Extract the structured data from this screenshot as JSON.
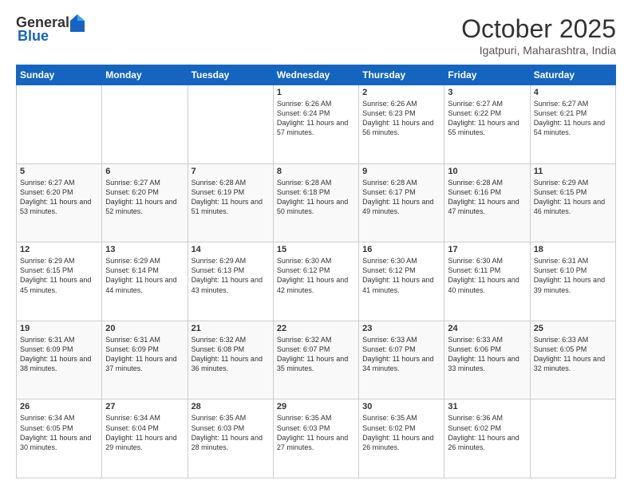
{
  "header": {
    "logo_general": "General",
    "logo_blue": "Blue",
    "month_title": "October 2025",
    "location": "Igatpuri, Maharashtra, India"
  },
  "days_of_week": [
    "Sunday",
    "Monday",
    "Tuesday",
    "Wednesday",
    "Thursday",
    "Friday",
    "Saturday"
  ],
  "weeks": [
    [
      {
        "day": "",
        "info": ""
      },
      {
        "day": "",
        "info": ""
      },
      {
        "day": "",
        "info": ""
      },
      {
        "day": "1",
        "info": "Sunrise: 6:26 AM\nSunset: 6:24 PM\nDaylight: 11 hours and 57 minutes."
      },
      {
        "day": "2",
        "info": "Sunrise: 6:26 AM\nSunset: 6:23 PM\nDaylight: 11 hours and 56 minutes."
      },
      {
        "day": "3",
        "info": "Sunrise: 6:27 AM\nSunset: 6:22 PM\nDaylight: 11 hours and 55 minutes."
      },
      {
        "day": "4",
        "info": "Sunrise: 6:27 AM\nSunset: 6:21 PM\nDaylight: 11 hours and 54 minutes."
      }
    ],
    [
      {
        "day": "5",
        "info": "Sunrise: 6:27 AM\nSunset: 6:20 PM\nDaylight: 11 hours and 53 minutes."
      },
      {
        "day": "6",
        "info": "Sunrise: 6:27 AM\nSunset: 6:20 PM\nDaylight: 11 hours and 52 minutes."
      },
      {
        "day": "7",
        "info": "Sunrise: 6:28 AM\nSunset: 6:19 PM\nDaylight: 11 hours and 51 minutes."
      },
      {
        "day": "8",
        "info": "Sunrise: 6:28 AM\nSunset: 6:18 PM\nDaylight: 11 hours and 50 minutes."
      },
      {
        "day": "9",
        "info": "Sunrise: 6:28 AM\nSunset: 6:17 PM\nDaylight: 11 hours and 49 minutes."
      },
      {
        "day": "10",
        "info": "Sunrise: 6:28 AM\nSunset: 6:16 PM\nDaylight: 11 hours and 47 minutes."
      },
      {
        "day": "11",
        "info": "Sunrise: 6:29 AM\nSunset: 6:15 PM\nDaylight: 11 hours and 46 minutes."
      }
    ],
    [
      {
        "day": "12",
        "info": "Sunrise: 6:29 AM\nSunset: 6:15 PM\nDaylight: 11 hours and 45 minutes."
      },
      {
        "day": "13",
        "info": "Sunrise: 6:29 AM\nSunset: 6:14 PM\nDaylight: 11 hours and 44 minutes."
      },
      {
        "day": "14",
        "info": "Sunrise: 6:29 AM\nSunset: 6:13 PM\nDaylight: 11 hours and 43 minutes."
      },
      {
        "day": "15",
        "info": "Sunrise: 6:30 AM\nSunset: 6:12 PM\nDaylight: 11 hours and 42 minutes."
      },
      {
        "day": "16",
        "info": "Sunrise: 6:30 AM\nSunset: 6:12 PM\nDaylight: 11 hours and 41 minutes."
      },
      {
        "day": "17",
        "info": "Sunrise: 6:30 AM\nSunset: 6:11 PM\nDaylight: 11 hours and 40 minutes."
      },
      {
        "day": "18",
        "info": "Sunrise: 6:31 AM\nSunset: 6:10 PM\nDaylight: 11 hours and 39 minutes."
      }
    ],
    [
      {
        "day": "19",
        "info": "Sunrise: 6:31 AM\nSunset: 6:09 PM\nDaylight: 11 hours and 38 minutes."
      },
      {
        "day": "20",
        "info": "Sunrise: 6:31 AM\nSunset: 6:09 PM\nDaylight: 11 hours and 37 minutes."
      },
      {
        "day": "21",
        "info": "Sunrise: 6:32 AM\nSunset: 6:08 PM\nDaylight: 11 hours and 36 minutes."
      },
      {
        "day": "22",
        "info": "Sunrise: 6:32 AM\nSunset: 6:07 PM\nDaylight: 11 hours and 35 minutes."
      },
      {
        "day": "23",
        "info": "Sunrise: 6:33 AM\nSunset: 6:07 PM\nDaylight: 11 hours and 34 minutes."
      },
      {
        "day": "24",
        "info": "Sunrise: 6:33 AM\nSunset: 6:06 PM\nDaylight: 11 hours and 33 minutes."
      },
      {
        "day": "25",
        "info": "Sunrise: 6:33 AM\nSunset: 6:05 PM\nDaylight: 11 hours and 32 minutes."
      }
    ],
    [
      {
        "day": "26",
        "info": "Sunrise: 6:34 AM\nSunset: 6:05 PM\nDaylight: 11 hours and 30 minutes."
      },
      {
        "day": "27",
        "info": "Sunrise: 6:34 AM\nSunset: 6:04 PM\nDaylight: 11 hours and 29 minutes."
      },
      {
        "day": "28",
        "info": "Sunrise: 6:35 AM\nSunset: 6:03 PM\nDaylight: 11 hours and 28 minutes."
      },
      {
        "day": "29",
        "info": "Sunrise: 6:35 AM\nSunset: 6:03 PM\nDaylight: 11 hours and 27 minutes."
      },
      {
        "day": "30",
        "info": "Sunrise: 6:35 AM\nSunset: 6:02 PM\nDaylight: 11 hours and 26 minutes."
      },
      {
        "day": "31",
        "info": "Sunrise: 6:36 AM\nSunset: 6:02 PM\nDaylight: 11 hours and 26 minutes."
      },
      {
        "day": "",
        "info": ""
      }
    ]
  ]
}
